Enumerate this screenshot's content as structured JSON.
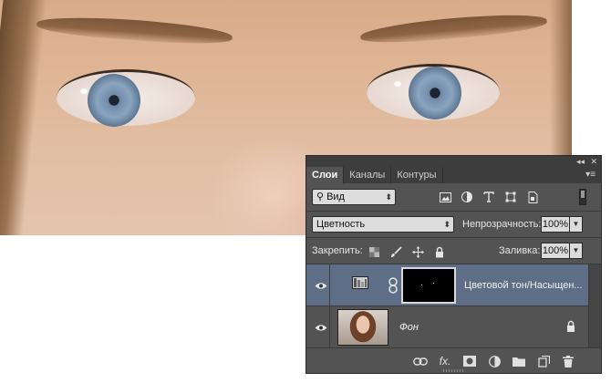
{
  "panel": {
    "tabs": [
      {
        "label": "Слои",
        "active": true
      },
      {
        "label": "Каналы",
        "active": false
      },
      {
        "label": "Контуры",
        "active": false
      }
    ],
    "filter": {
      "kind_label": "Вид"
    },
    "blend_mode": "Цветность",
    "opacity_label": "Непрозрачность:",
    "opacity_value": "100%",
    "lock_label": "Закрепить:",
    "fill_label": "Заливка:",
    "fill_value": "100%",
    "layers": [
      {
        "name": "Цветовой тон/Насыщен...",
        "type": "adjustment",
        "selected": true,
        "visible": true
      },
      {
        "name": "Фон",
        "type": "background",
        "selected": false,
        "visible": true,
        "locked": true
      }
    ],
    "accent_selected": "#5e6e86",
    "panel_bg": "#535353"
  }
}
